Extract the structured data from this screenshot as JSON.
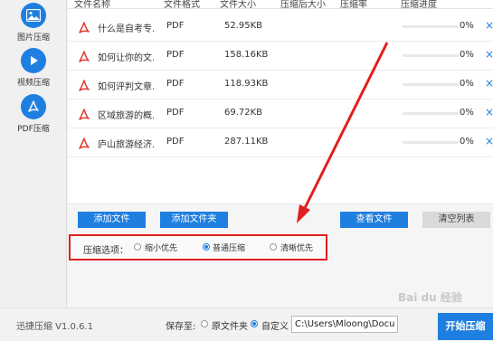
{
  "sidebar": {
    "items": [
      {
        "label": "图片压缩",
        "icon": "image-icon"
      },
      {
        "label": "视频压缩",
        "icon": "play-icon"
      },
      {
        "label": "PDF压缩",
        "icon": "pdf-icon"
      }
    ]
  },
  "table": {
    "headers": [
      "文件名称",
      "文件格式",
      "文件大小",
      "压缩后大小",
      "压缩率",
      "压缩进度"
    ],
    "rows": [
      {
        "name": "什么是自考专...",
        "format": "PDF",
        "size": "52.95KB",
        "progress": 0,
        "percent": "0%"
      },
      {
        "name": "如何让你的文...",
        "format": "PDF",
        "size": "158.16KB",
        "progress": 0,
        "percent": "0%"
      },
      {
        "name": "如何评判文章...",
        "format": "PDF",
        "size": "118.93KB",
        "progress": 0,
        "percent": "0%"
      },
      {
        "name": "区域旅游的概...",
        "format": "PDF",
        "size": "69.72KB",
        "progress": 0,
        "percent": "0%"
      },
      {
        "name": "庐山旅游经济...",
        "format": "PDF",
        "size": "287.11KB",
        "progress": 0,
        "percent": "0%"
      }
    ],
    "close_glyph": "×"
  },
  "buttons": {
    "add_file": "添加文件",
    "add_folder": "添加文件夹",
    "view_files": "查看文件",
    "clear_list": "清空列表"
  },
  "compress_options": {
    "title": "压缩选项：",
    "options": [
      "缩小优先",
      "普通压缩",
      "清晰优先"
    ],
    "selected": "普通压缩"
  },
  "footer": {
    "version": "迅捷压缩 V1.0.6.1",
    "save_to": "保存至:",
    "original_folder": "原文件夹",
    "custom": "自定义",
    "path_value": "C:\\Users\\Mloong\\Docum",
    "start": "开始压缩"
  },
  "watermark": "Bai du 经验",
  "colors": {
    "accent": "#1e7fe0",
    "annotation": "#e02020",
    "pdf_red": "#e03c31"
  }
}
